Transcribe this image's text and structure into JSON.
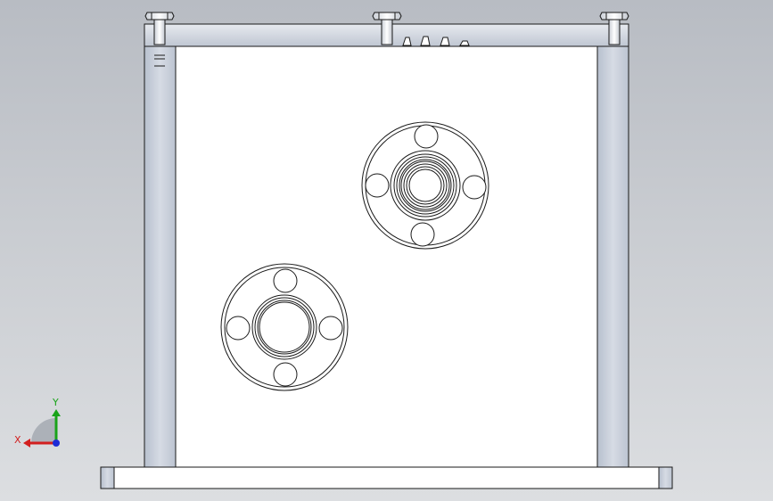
{
  "viewport": {
    "background_top": "#b8bcc3",
    "background_bottom": "#dcdee1"
  },
  "model": {
    "body_color": "#ffffff",
    "frame_color": "#c5ccd9",
    "edge_color": "#1a1a1a",
    "bolt_color": "#e6e8ec"
  },
  "triad": {
    "x_label": "X",
    "y_label": "Y",
    "x_color": "#d21f1f",
    "y_color": "#19a319",
    "z_color": "#1d2bd6"
  }
}
